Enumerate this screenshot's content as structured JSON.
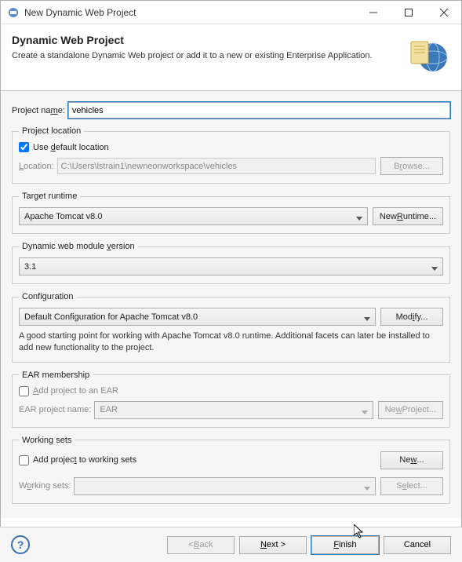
{
  "window": {
    "title": "New Dynamic Web Project"
  },
  "banner": {
    "title": "Dynamic Web Project",
    "desc": "Create a standalone Dynamic Web project or add it to a new or existing Enterprise Application."
  },
  "project_name": {
    "label": "Project name:",
    "value": "vehicles",
    "underline": "m"
  },
  "project_location": {
    "legend": "Project location",
    "use_default_label": "Use default location",
    "use_default_checked": true,
    "location_label": "Location:",
    "location_value": "C:\\Users\\lstrain1\\newneonworkspace\\vehicles",
    "browse": "Browse..."
  },
  "target_runtime": {
    "legend": "Target runtime",
    "value": "Apache Tomcat v8.0",
    "new_runtime": "New Runtime..."
  },
  "module_version": {
    "legend": "Dynamic web module version",
    "value": "3.1"
  },
  "configuration": {
    "legend": "Configuration",
    "value": "Default Configuration for Apache Tomcat v8.0",
    "modify": "Modify...",
    "desc": "A good starting point for working with Apache Tomcat v8.0 runtime. Additional facets can later be installed to add new functionality to the project."
  },
  "ear": {
    "legend": "EAR membership",
    "add_label": "Add project to an EAR",
    "add_checked": false,
    "name_label": "EAR project name:",
    "name_value": "EAR",
    "new_project": "New Project..."
  },
  "working_sets": {
    "legend": "Working sets",
    "add_label": "Add project to working sets",
    "add_checked": false,
    "new": "New...",
    "label": "Working sets:",
    "value": "",
    "select": "Select..."
  },
  "footer": {
    "back": "< Back",
    "next": "Next >",
    "finish": "Finish",
    "cancel": "Cancel"
  }
}
